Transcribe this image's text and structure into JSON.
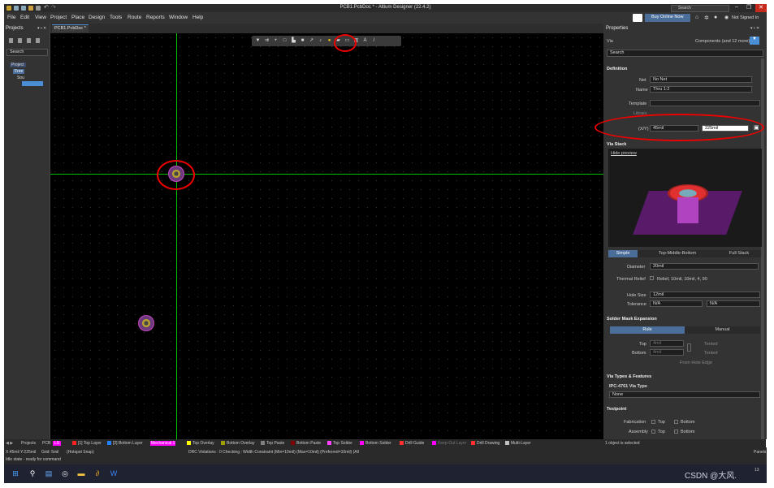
{
  "window": {
    "title": "PCB1.PcbDoc * - Altium Designer (22.4.2)",
    "search_placeholder": "Search"
  },
  "menu": [
    "File",
    "Edit",
    "View",
    "Project",
    "Place",
    "Design",
    "Tools",
    "Route",
    "Reports",
    "Window",
    "Help"
  ],
  "header_right": {
    "buy": "Buy Online Now",
    "signed": "Not Signed In"
  },
  "projects": {
    "title": "Projects",
    "search_placeholder": "Search",
    "tree": [
      "Project",
      "Free",
      "Sou"
    ]
  },
  "doc_tab": "PCB1.PcbDoc *",
  "properties": {
    "title": "Properties",
    "object": "Via",
    "filter": "Components (and 12 more)",
    "search_placeholder": "Search",
    "definition": {
      "title": "Definition",
      "net_label": "Net",
      "net_value": "No Net",
      "name_label": "Name",
      "name_value": "Thru 1:2",
      "template_label": "Template",
      "library_label": "Library",
      "xy_label": "(X/Y)",
      "x": "45mil",
      "y": "225mil"
    },
    "via_stack": {
      "title": "Via Stack",
      "hide_preview": "Hide preview",
      "tabs": [
        "Simple",
        "Top-Middle-Bottom",
        "Full Stack"
      ],
      "diameter_label": "Diameter",
      "diameter": "20mil",
      "thermal_label": "Thermal Relief",
      "thermal_value": "Relief, 10mil, 10mil, 4, 90",
      "hole_label": "Hole Size",
      "hole": "12mil",
      "tol_label": "Tolerance",
      "tol_minus": "N/A",
      "tol_plus": "N/A"
    },
    "solder_mask": {
      "title": "Solder Mask Expansion",
      "tabs": [
        "Rule",
        "Manual"
      ],
      "top_label": "Top",
      "top_val": "4mil",
      "bottom_label": "Bottom",
      "bottom_val": "4mil",
      "tented": "Tented",
      "from_hole": "From Hole Edge"
    },
    "via_types": {
      "title": "Via Types & Features",
      "ipc_label": "IPC-4761 Via Type",
      "ipc_value": "None"
    },
    "testpoint": {
      "title": "Testpoint",
      "fab_label": "Fabrication",
      "asm_label": "Assembly",
      "top": "Top",
      "bottom": "Bottom"
    }
  },
  "layers": [
    {
      "name": "Projects",
      "color": ""
    },
    {
      "name": "PCB",
      "color": ""
    },
    {
      "name": "LS",
      "color": "#ff00ff"
    },
    {
      "name": "[1] Top Layer",
      "color": "#ff2020"
    },
    {
      "name": "[2] Bottom Layer",
      "color": "#2080ff"
    },
    {
      "name": "Mechanical 1",
      "color": "#ff00ff"
    },
    {
      "name": "Top Overlay",
      "color": "#ffff00"
    },
    {
      "name": "Bottom Overlay",
      "color": "#a0a000"
    },
    {
      "name": "Top Paste",
      "color": "#808080"
    },
    {
      "name": "Bottom Paste",
      "color": "#800000"
    },
    {
      "name": "Top Solder",
      "color": "#ff40ff"
    },
    {
      "name": "Bottom Solder",
      "color": "#ff00ff"
    },
    {
      "name": "Drill Guide",
      "color": "#ff3030"
    },
    {
      "name": "Keep-Out Layer",
      "color": "#ff00ff"
    },
    {
      "name": "Drill Drawing",
      "color": "#ff3030"
    },
    {
      "name": "Multi-Layer",
      "color": "#c0c0c0"
    }
  ],
  "status": {
    "coords": "X:45mil Y:225mil",
    "grid": "Grid: 5mil",
    "snap": "(Hotspot Snap)",
    "drc": "DRC Violations : 0 Checking : Width Constraint (Min=10mil) (Max=10mil) (Preferred=10mil) (All",
    "selected": "1 object is selected",
    "panels": "Panels",
    "idle": "Idle state - ready for command"
  },
  "taskbar": {
    "watermark": "CSDN @大风.",
    "time": "13"
  },
  "colors": {
    "accent": "#4a6d99",
    "canvas": "#000000",
    "crosshair": "#00c000",
    "highlight": "#e00000"
  }
}
